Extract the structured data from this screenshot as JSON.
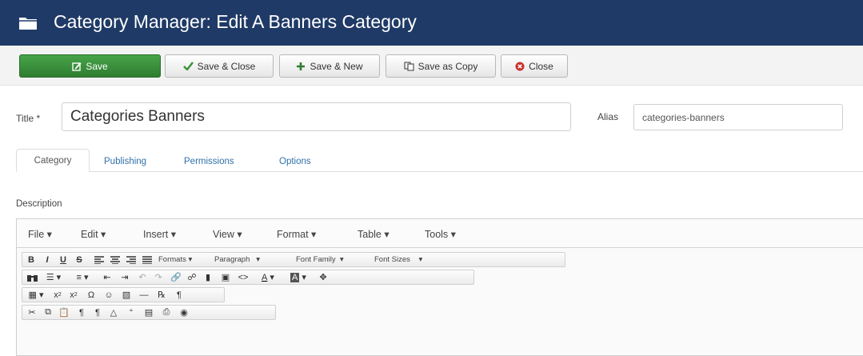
{
  "header": {
    "title": "Category Manager: Edit A Banners Category"
  },
  "toolbar": {
    "save": "Save",
    "save_close": "Save & Close",
    "save_new": "Save & New",
    "save_copy": "Save as Copy",
    "close": "Close"
  },
  "form": {
    "title_label": "Title *",
    "title_value": "Categories Banners",
    "alias_label": "Alias",
    "alias_value": "categories-banners"
  },
  "tabs": [
    "Category",
    "Publishing",
    "Permissions",
    "Options"
  ],
  "description_label": "Description",
  "editor": {
    "menus": [
      "File ▾",
      "Edit ▾",
      "Insert ▾",
      "View ▾",
      "Format ▾",
      "Table ▾",
      "Tools ▾"
    ],
    "selects": {
      "formats": "Formats ▾",
      "paragraph": "Paragraph",
      "font_family": "Font Family",
      "font_sizes": "Font Sizes"
    }
  },
  "colors": {
    "header_bg": "#1f3a66",
    "save_green": "#3a913b",
    "link_blue": "#3071a9",
    "close_red": "#c9302c"
  }
}
